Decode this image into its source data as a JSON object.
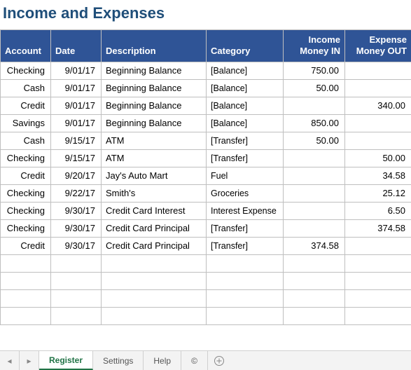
{
  "title": "Income and Expenses",
  "columns": {
    "account": "Account",
    "date": "Date",
    "description": "Description",
    "category": "Category",
    "income": "Income Money IN",
    "expense": "Expense Money OUT"
  },
  "rows": [
    {
      "account": "Checking",
      "date": "9/01/17",
      "description": "Beginning Balance",
      "category": "[Balance]",
      "income": "750.00",
      "expense": ""
    },
    {
      "account": "Cash",
      "date": "9/01/17",
      "description": "Beginning Balance",
      "category": "[Balance]",
      "income": "50.00",
      "expense": ""
    },
    {
      "account": "Credit",
      "date": "9/01/17",
      "description": "Beginning Balance",
      "category": "[Balance]",
      "income": "",
      "expense": "340.00"
    },
    {
      "account": "Savings",
      "date": "9/01/17",
      "description": "Beginning Balance",
      "category": "[Balance]",
      "income": "850.00",
      "expense": ""
    },
    {
      "account": "Cash",
      "date": "9/15/17",
      "description": "ATM",
      "category": "[Transfer]",
      "income": "50.00",
      "expense": ""
    },
    {
      "account": "Checking",
      "date": "9/15/17",
      "description": "ATM",
      "category": "[Transfer]",
      "income": "",
      "expense": "50.00"
    },
    {
      "account": "Credit",
      "date": "9/20/17",
      "description": "Jay's Auto Mart",
      "category": "Fuel",
      "income": "",
      "expense": "34.58"
    },
    {
      "account": "Checking",
      "date": "9/22/17",
      "description": "Smith's",
      "category": "Groceries",
      "income": "",
      "expense": "25.12"
    },
    {
      "account": "Checking",
      "date": "9/30/17",
      "description": "Credit Card Interest",
      "category": "Interest Expense",
      "income": "",
      "expense": "6.50"
    },
    {
      "account": "Checking",
      "date": "9/30/17",
      "description": "Credit Card Principal",
      "category": "[Transfer]",
      "income": "",
      "expense": "374.58"
    },
    {
      "account": "Credit",
      "date": "9/30/17",
      "description": "Credit Card Principal",
      "category": "[Transfer]",
      "income": "374.58",
      "expense": ""
    },
    {
      "account": "",
      "date": "",
      "description": "",
      "category": "",
      "income": "",
      "expense": ""
    },
    {
      "account": "",
      "date": "",
      "description": "",
      "category": "",
      "income": "",
      "expense": ""
    },
    {
      "account": "",
      "date": "",
      "description": "",
      "category": "",
      "income": "",
      "expense": ""
    },
    {
      "account": "",
      "date": "",
      "description": "",
      "category": "",
      "income": "",
      "expense": ""
    }
  ],
  "tabs": {
    "prev": "◂",
    "next": "▸",
    "items": [
      {
        "label": "Register",
        "active": true
      },
      {
        "label": "Settings",
        "active": false
      },
      {
        "label": "Help",
        "active": false
      },
      {
        "label": "©",
        "active": false
      }
    ]
  },
  "chart_data": {
    "type": "table",
    "title": "Income and Expenses",
    "columns": [
      "Account",
      "Date",
      "Description",
      "Category",
      "Income Money IN",
      "Expense Money OUT"
    ],
    "rows": [
      [
        "Checking",
        "9/01/17",
        "Beginning Balance",
        "[Balance]",
        750.0,
        null
      ],
      [
        "Cash",
        "9/01/17",
        "Beginning Balance",
        "[Balance]",
        50.0,
        null
      ],
      [
        "Credit",
        "9/01/17",
        "Beginning Balance",
        "[Balance]",
        null,
        340.0
      ],
      [
        "Savings",
        "9/01/17",
        "Beginning Balance",
        "[Balance]",
        850.0,
        null
      ],
      [
        "Cash",
        "9/15/17",
        "ATM",
        "[Transfer]",
        50.0,
        null
      ],
      [
        "Checking",
        "9/15/17",
        "ATM",
        "[Transfer]",
        null,
        50.0
      ],
      [
        "Credit",
        "9/20/17",
        "Jay's Auto Mart",
        "Fuel",
        null,
        34.58
      ],
      [
        "Checking",
        "9/22/17",
        "Smith's",
        "Groceries",
        null,
        25.12
      ],
      [
        "Checking",
        "9/30/17",
        "Credit Card Interest",
        "Interest Expense",
        null,
        6.5
      ],
      [
        "Checking",
        "9/30/17",
        "Credit Card Principal",
        "[Transfer]",
        null,
        374.58
      ],
      [
        "Credit",
        "9/30/17",
        "Credit Card Principal",
        "[Transfer]",
        374.58,
        null
      ]
    ]
  }
}
